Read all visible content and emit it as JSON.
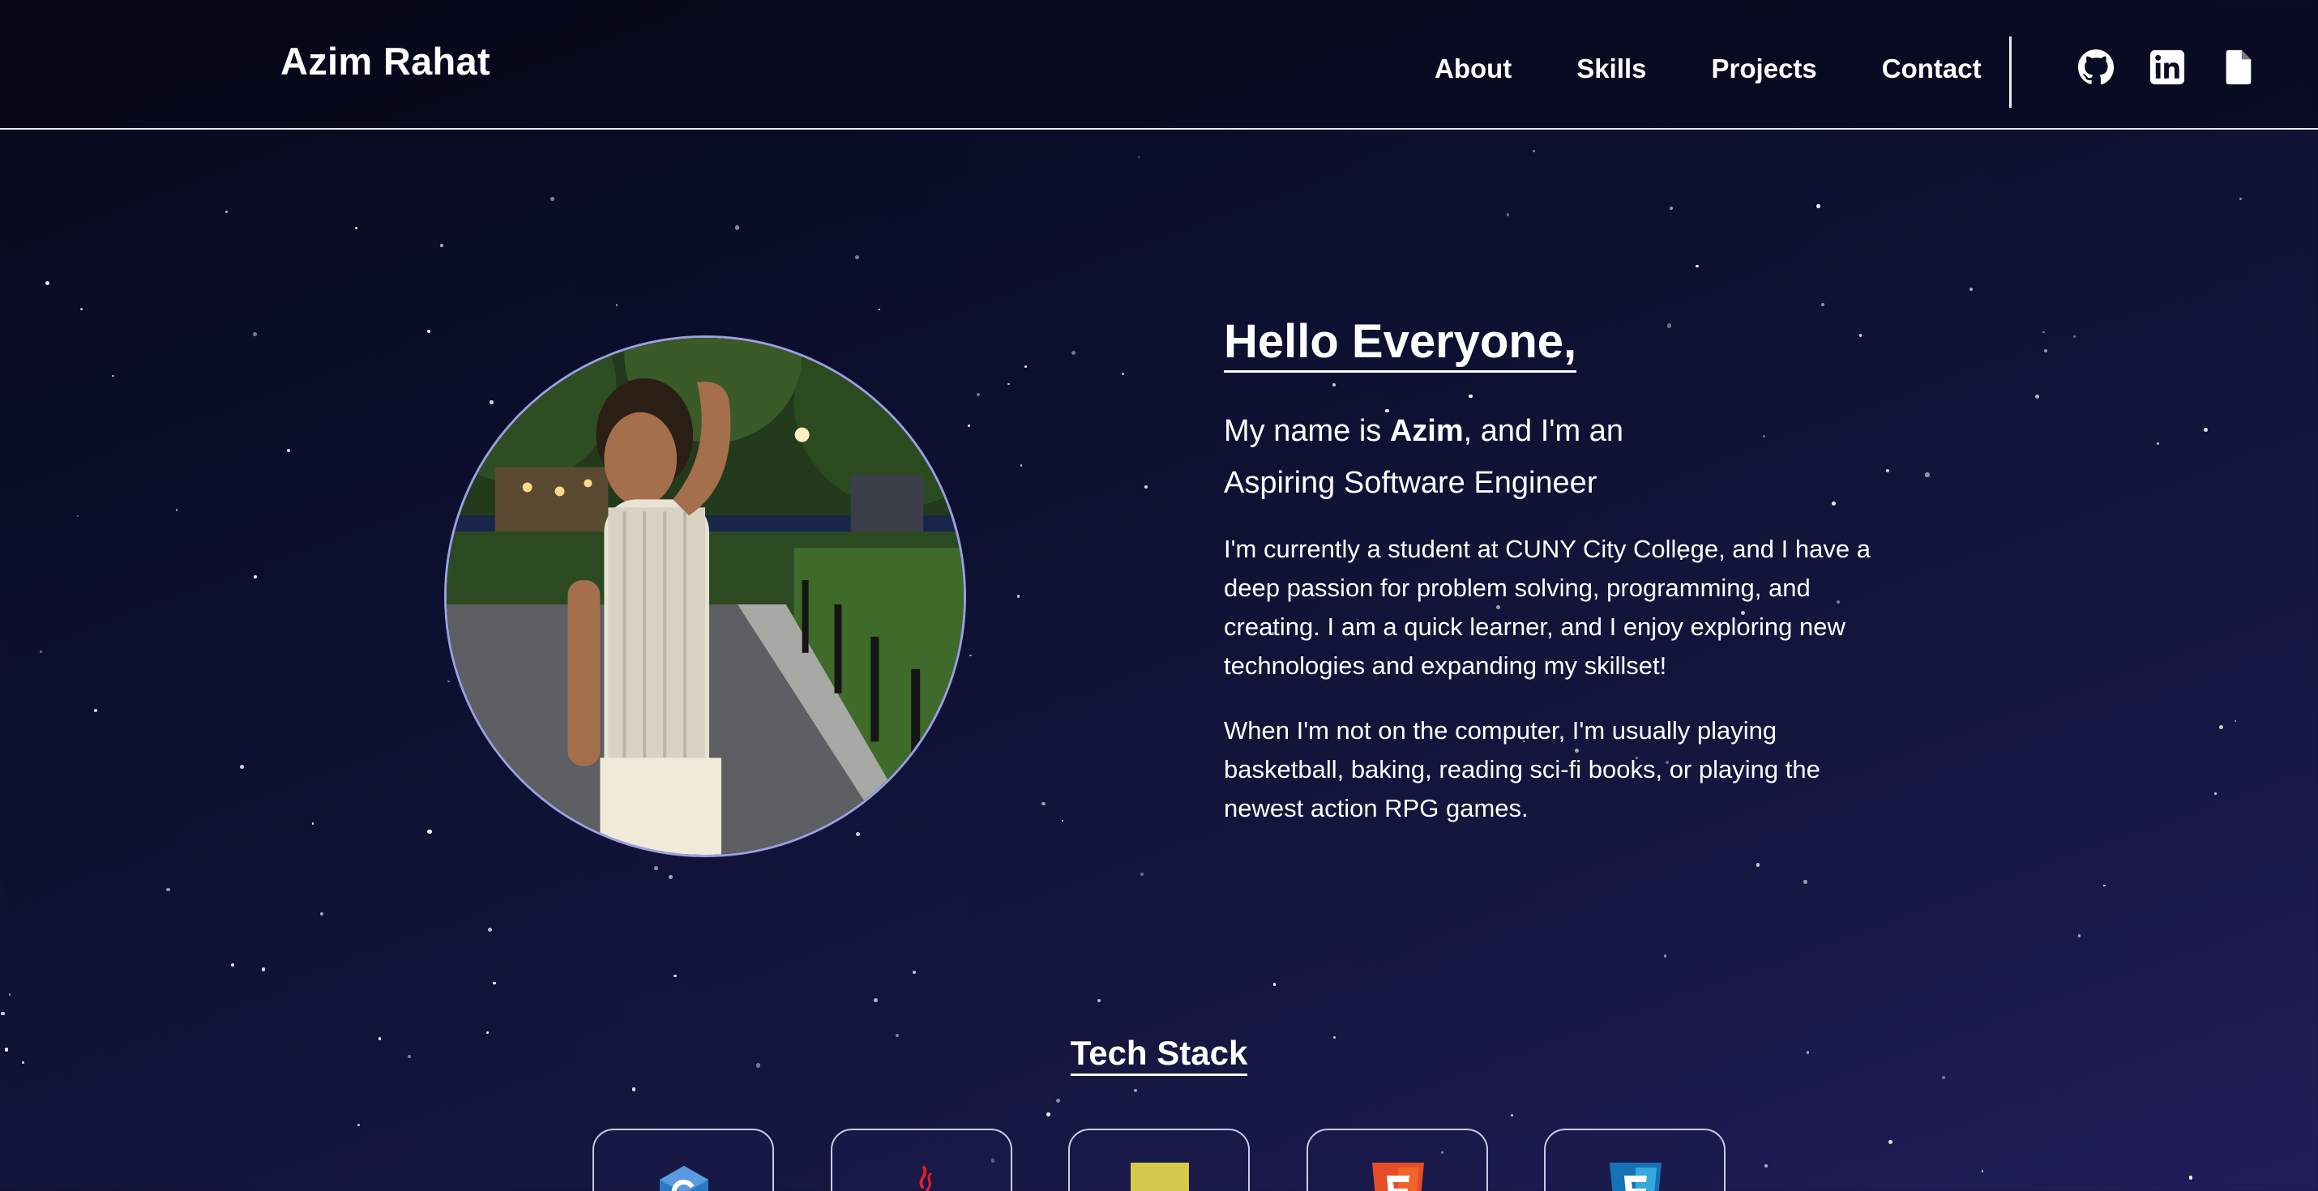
{
  "header": {
    "brand": "Azim Rahat",
    "nav": [
      "About",
      "Skills",
      "Projects",
      "Contact"
    ],
    "icons": [
      "github-icon",
      "linkedin-icon",
      "resume-file-icon"
    ]
  },
  "hero": {
    "greeting": "Hello Everyone,",
    "lead_prefix": "My name is ",
    "lead_name": "Azim",
    "lead_suffix": ", and I'm an",
    "lead_role": "Aspiring Software Engineer",
    "para1": "I'm currently a student at CUNY City College, and I have a deep passion for problem solving, programming, and creating. I am a quick learner, and I enjoy exploring new technologies and expanding my skillset!",
    "para2": "When I'm not on the computer, I'm usually playing basketball, baking, reading sci-fi books, or playing the newest action RPG games."
  },
  "tech_stack": {
    "title": "Tech Stack",
    "items": [
      "c-logo-icon",
      "java-logo-icon",
      "javascript-logo-icon",
      "html5-logo-icon",
      "css3-logo-icon"
    ]
  },
  "colors": {
    "background_top": "#070a1a",
    "background_bottom": "#211d5a",
    "card_border": "#c9cbe6",
    "photo_border": "#9aa0e0"
  }
}
